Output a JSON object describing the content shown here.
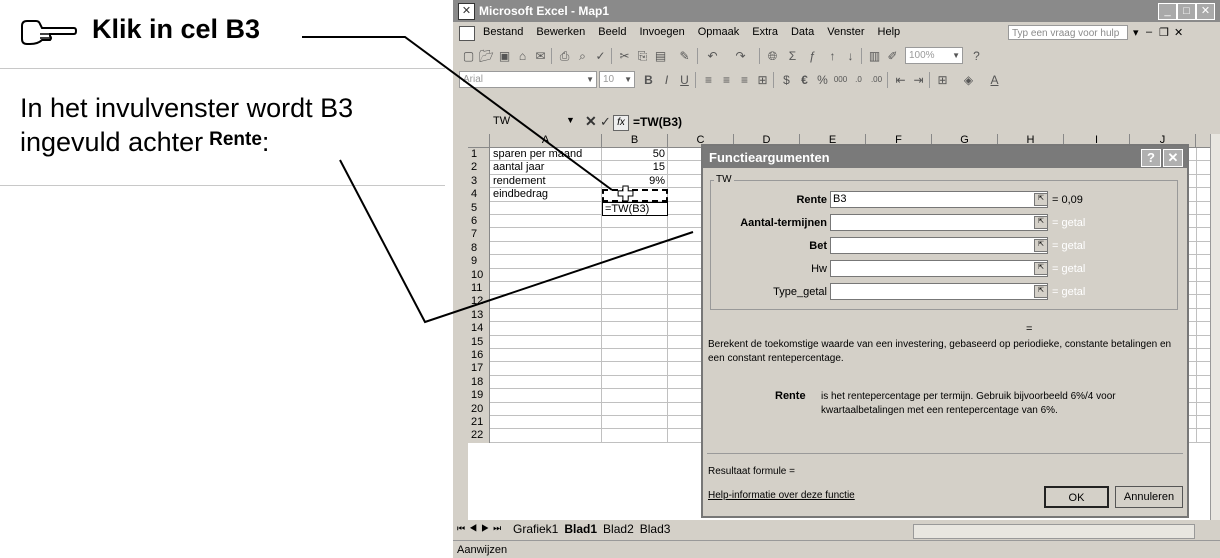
{
  "instruction": {
    "title": "Klik in cel B3",
    "line1": "In het invulvenster wordt B3",
    "line2_prefix": "ingevuld achter",
    "line2_keyword": "Rente",
    "line2_suffix": ":"
  },
  "excel": {
    "window_title": "Microsoft Excel - Map1",
    "menu": [
      "Bestand",
      "Bewerken",
      "Beeld",
      "Invoegen",
      "Opmaak",
      "Extra",
      "Data",
      "Venster",
      "Help"
    ],
    "ask_placeholder": "Typ een vraag voor hulp",
    "toolbar": {
      "zoom": "100%",
      "font_name": "Arial",
      "font_size": "10"
    },
    "formula_bar": {
      "name_box": "TW",
      "formula": "=TW(B3)"
    },
    "columns": [
      "A",
      "B",
      "C",
      "D",
      "E",
      "F",
      "G",
      "H",
      "I",
      "J"
    ],
    "rows": [
      {
        "n": "1",
        "a": "sparen per maand",
        "b": "50"
      },
      {
        "n": "2",
        "a": "aantal jaar",
        "b": "15"
      },
      {
        "n": "3",
        "a": "rendement",
        "b": "9%"
      },
      {
        "n": "4",
        "a": "eindbedrag",
        "b": "=TW(B3)"
      },
      {
        "n": "5",
        "a": "",
        "b": ""
      },
      {
        "n": "6",
        "a": "",
        "b": ""
      },
      {
        "n": "7",
        "a": "",
        "b": ""
      },
      {
        "n": "8",
        "a": "",
        "b": ""
      },
      {
        "n": "9",
        "a": "",
        "b": ""
      },
      {
        "n": "10",
        "a": "",
        "b": ""
      },
      {
        "n": "11",
        "a": "",
        "b": ""
      },
      {
        "n": "12",
        "a": "",
        "b": ""
      },
      {
        "n": "13",
        "a": "",
        "b": ""
      },
      {
        "n": "14",
        "a": "",
        "b": ""
      },
      {
        "n": "15",
        "a": "",
        "b": ""
      },
      {
        "n": "16",
        "a": "",
        "b": ""
      },
      {
        "n": "17",
        "a": "",
        "b": ""
      },
      {
        "n": "18",
        "a": "",
        "b": ""
      },
      {
        "n": "19",
        "a": "",
        "b": ""
      },
      {
        "n": "20",
        "a": "",
        "b": ""
      },
      {
        "n": "21",
        "a": "",
        "b": ""
      },
      {
        "n": "22",
        "a": "",
        "b": ""
      }
    ],
    "sheet_tabs": [
      "Grafiek1",
      "Blad1",
      "Blad2",
      "Blad3"
    ],
    "active_sheet": "Blad1",
    "status": "Aanwijzen"
  },
  "dialog": {
    "title": "Functieargumenten",
    "group_label": "TW",
    "args": [
      {
        "label": "Rente",
        "value": "B3",
        "result": "= 0,09",
        "bold": true
      },
      {
        "label": "Aantal-termijnen",
        "value": "",
        "result": "= getal",
        "bold": true
      },
      {
        "label": "Bet",
        "value": "",
        "result": "= getal",
        "bold": true
      },
      {
        "label": "Hw",
        "value": "",
        "result": "= getal",
        "bold": false
      },
      {
        "label": "Type_getal",
        "value": "",
        "result": "= getal",
        "bold": false
      }
    ],
    "result_eq": "=",
    "description": "Berekent de toekomstige waarde van een investering, gebaseerd op periodieke, constante betalingen en een constant rentepercentage.",
    "arg_help_name": "Rente",
    "arg_help_text": "is het rentepercentage per termijn. Gebruik bijvoorbeeld 6%/4 voor kwartaalbetalingen met een rentepercentage van 6%.",
    "result_label": "Resultaat formule =",
    "help_link": "Help-informatie over deze functie",
    "ok": "OK",
    "cancel": "Annuleren"
  }
}
